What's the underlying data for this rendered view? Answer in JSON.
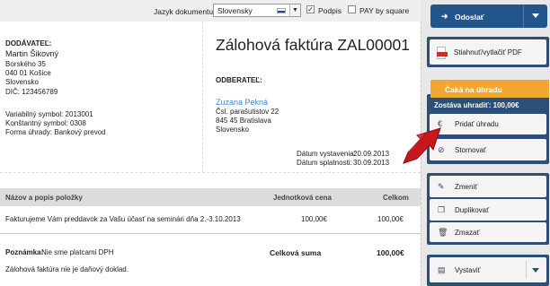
{
  "toolbar": {
    "language_label": "Jazyk dokumentu",
    "language_value": "Slovensky",
    "signature_label": "Podpis",
    "signature_checked": true,
    "pay_by_square_label": "PAY by square",
    "pay_by_square_checked": false
  },
  "supplier": {
    "heading": "DODÁVATEĽ:",
    "name": "Martin Šikovný",
    "street": "Borského 35",
    "city": "040 01 Košice",
    "country": "Slovensko",
    "dic": "DIČ: 123456789",
    "variable_symbol": "Variabilný symbol: 2013001",
    "constant_symbol": "Konštantný symbol: 0308",
    "payment_method": "Forma úhrady: Bankový prevod"
  },
  "invoice": {
    "title": "Zálohová faktúra ZAL00001",
    "issue_date_label": "Dátum vystavenia:",
    "issue_date": "20.09.2013",
    "due_date_label": "Dátum splatnosti:",
    "due_date": "30.09.2013"
  },
  "customer": {
    "heading": "ODBERATEĽ:",
    "name": "Zuzana Pekná",
    "street": "Čsl. parašutistov 22",
    "city": "845 45 Bratislava",
    "country": "Slovensko"
  },
  "table": {
    "headers": {
      "item": "Názov a popis položky",
      "unit_price": "Jednotková cena",
      "total": "Celkom"
    },
    "rows": [
      {
        "item": "Fakturujeme Vám preddavok za Vašu účasť na seminári dňa 2.-3.10.2013",
        "unit_price": "100,00€",
        "total": "100,00€"
      }
    ]
  },
  "summary": {
    "note_label": "Poznámka:",
    "note_text": "Nie sme platcami DPH",
    "total_label": "Celková suma",
    "total_value": "100,00€",
    "footer_note": "Zálohová faktúra nie je daňový doklad."
  },
  "sidebar": {
    "send_label": "Odoslať",
    "download_label": "Stiahnuť/vytlačiť PDF",
    "status_label": "Čaká na úhradu",
    "remaining_label": "Zostáva uhradiť: 100,00€",
    "add_payment_label": "Pridať úhradu",
    "cancel_label": "Stornovať",
    "edit_label": "Zmeniť",
    "duplicate_label": "Duplikovať",
    "delete_label": "Zmazať",
    "issue_label": "Vystaviť"
  },
  "colors": {
    "primary": "#21558c",
    "panel": "#2c4f7a",
    "status": "#f0a830",
    "link": "#4a86c8",
    "annotation_arrow": "#c8161d"
  }
}
